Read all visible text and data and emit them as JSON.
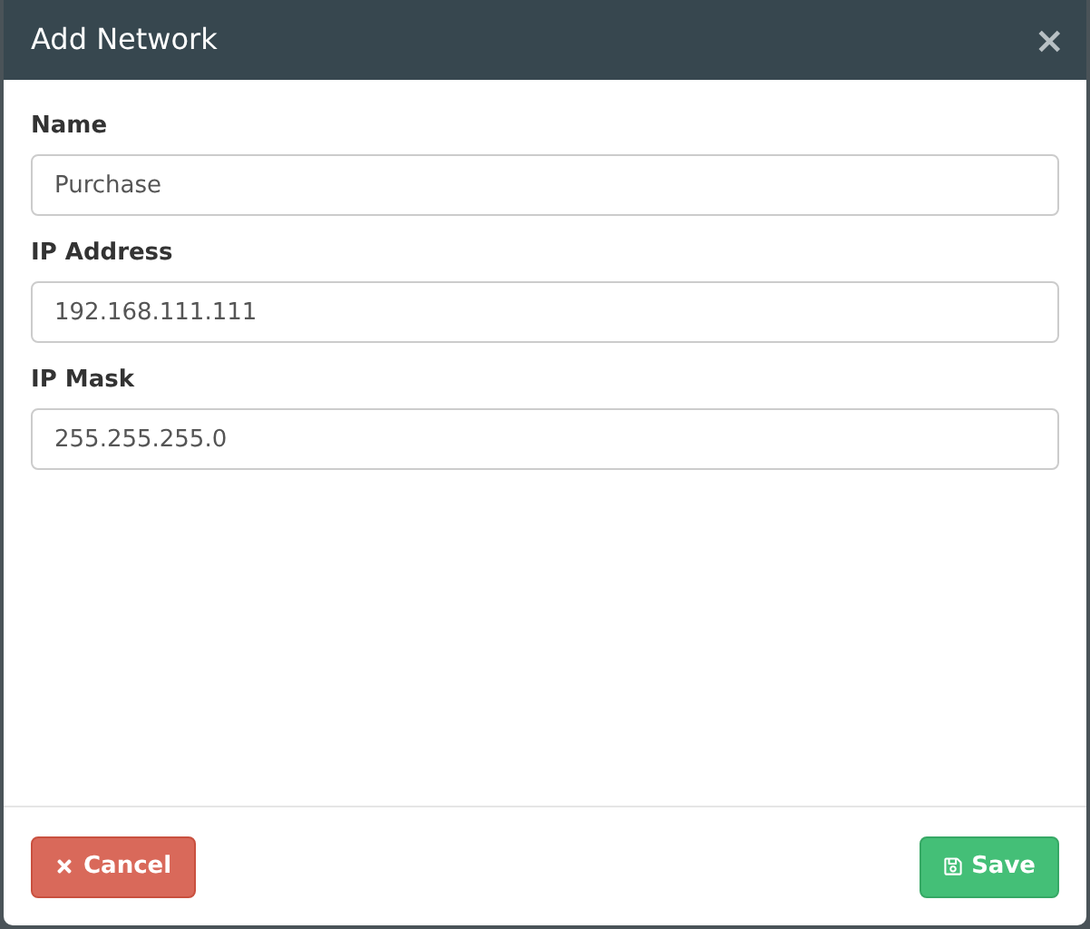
{
  "dialog": {
    "title": "Add Network",
    "close": "×"
  },
  "fields": [
    {
      "label": "Name",
      "value": "Purchase"
    },
    {
      "label": "IP Address",
      "value": "192.168.111.111"
    },
    {
      "label": "IP Mask",
      "value": "255.255.255.0"
    }
  ],
  "buttons": [
    {
      "kind": "cancel",
      "label": "Cancel"
    },
    {
      "kind": "save",
      "label": "Save"
    }
  ]
}
